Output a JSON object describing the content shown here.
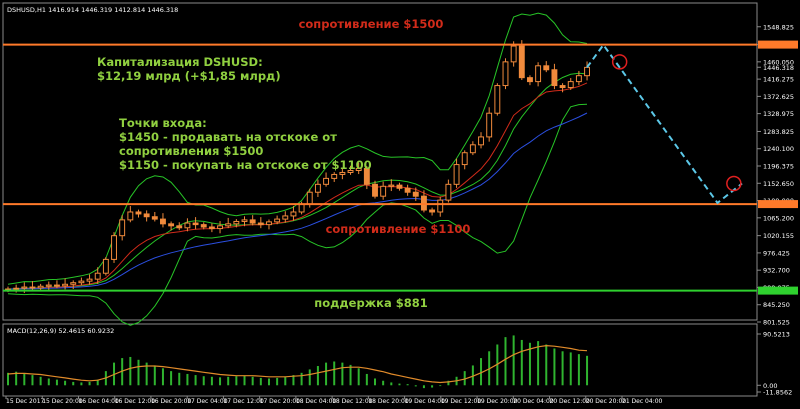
{
  "header": {
    "symbol_line": "DSHUSD,H1  1416.914 1446.319 1412.814 1446.318",
    "macd_line": "MACD(12,26,9) 52.4615 60.9232"
  },
  "annotations": {
    "resistance_top": "сопротивление $1500",
    "cap_line1": "Капитализация DSHUSD:",
    "cap_line2": "$12,19 млрд (+$1,85 млрд)",
    "entry_title": "Точки входа:",
    "entry_1": "$1450 - продавать на отскоке от",
    "entry_2": "сопротивления $1500",
    "entry_3": "$1150 - покупать на отскоке от $1100",
    "resistance_mid": "сопротивление $1100",
    "support": "поддержка $881"
  },
  "colors": {
    "background": "#000000",
    "candle_up": "#f08a3c",
    "candle_down": "#f08a3c",
    "resistance_line": "#ff7a2a",
    "support_line": "#2fd12f",
    "bollinger": "#27c427",
    "ma_red": "#d12b1a",
    "ma_blue": "#2b4fe0",
    "ma_green": "#27c427",
    "forecast": "#5cc8e8",
    "annotation_green": "#90d040",
    "annotation_red": "#d12b1a",
    "macd_bar": "#2fb42f",
    "macd_signal": "#e08a2a"
  },
  "chart_data": {
    "type": "candlestick",
    "symbol": "DSHUSD",
    "timeframe": "H1",
    "last_ohlc": {
      "open": 1416.914,
      "high": 1446.319,
      "low": 1412.814,
      "close": 1446.318
    },
    "price_ticks": [
      "1548.825",
      "1503.684",
      "1460.050",
      "1446.318",
      "1416.275",
      "1372.625",
      "1328.975",
      "1283.825",
      "1240.100",
      "1196.375",
      "1152.650",
      "1109.000",
      "1065.200",
      "1020.155",
      "976.425",
      "932.700",
      "888.975",
      "845.250",
      "801.525"
    ],
    "price_tick_values": [
      1548.825,
      1503.684,
      1460.05,
      1446.318,
      1416.275,
      1372.625,
      1328.975,
      1283.825,
      1240.1,
      1196.375,
      1152.65,
      1109.0,
      1065.2,
      1020.155,
      976.425,
      932.7,
      888.975,
      845.25,
      801.525
    ],
    "price_range": [
      801.525,
      1571
    ],
    "time_labels": [
      "15 Dec 2017",
      "15 Dec 20:00",
      "16 Dec 04:00",
      "16 Dec 12:00",
      "16 Dec 20:00",
      "17 Dec 04:00",
      "17 Dec 12:00",
      "17 Dec 20:00",
      "18 Dec 04:00",
      "18 Dec 12:00",
      "18 Dec 20:00",
      "19 Dec 04:00",
      "19 Dec 12:00",
      "19 Dec 20:00",
      "20 Dec 04:00",
      "20 Dec 12:00",
      "20 Dec 20:00",
      "21 Dec 04:00"
    ],
    "levels": [
      {
        "label": "сопротивление $1500",
        "value": 1503.684,
        "kind": "resistance"
      },
      {
        "label": "сопротивление $1100",
        "value": 1100,
        "kind": "resistance"
      },
      {
        "label": "поддержка $881",
        "value": 881,
        "kind": "support"
      }
    ],
    "price_series": [
      885,
      887,
      890,
      888,
      892,
      895,
      893,
      897,
      901,
      905,
      910,
      925,
      960,
      1020,
      1060,
      1080,
      1075,
      1068,
      1062,
      1050,
      1045,
      1040,
      1052,
      1048,
      1042,
      1038,
      1045,
      1050,
      1056,
      1060,
      1052,
      1048,
      1055,
      1062,
      1070,
      1080,
      1100,
      1130,
      1150,
      1165,
      1175,
      1180,
      1185,
      1190,
      1150,
      1120,
      1145,
      1148,
      1140,
      1130,
      1120,
      1085,
      1080,
      1110,
      1150,
      1200,
      1230,
      1250,
      1270,
      1330,
      1400,
      1460,
      1500,
      1420,
      1410,
      1450,
      1440,
      1400,
      1395,
      1410,
      1425,
      1446
    ],
    "forecast_path": [
      {
        "t": 71,
        "price": 1446
      },
      {
        "t": 73,
        "price": 1503
      },
      {
        "t": 87,
        "price": 1103
      },
      {
        "t": 90,
        "price": 1152
      }
    ],
    "targets": [
      {
        "t": 75,
        "price": 1460
      },
      {
        "t": 89,
        "price": 1152
      }
    ],
    "macd": {
      "ticks": [
        "90.5213",
        "0.00",
        "-11.8562"
      ],
      "tick_values": [
        90.5213,
        0,
        -11.8562
      ],
      "range": [
        -11.8562,
        90.5213
      ],
      "histogram": [
        22,
        24,
        20,
        18,
        15,
        12,
        10,
        8,
        6,
        5,
        6,
        10,
        25,
        40,
        48,
        50,
        45,
        40,
        35,
        30,
        25,
        22,
        20,
        18,
        16,
        15,
        14,
        15,
        16,
        17,
        15,
        13,
        12,
        13,
        15,
        18,
        22,
        28,
        34,
        40,
        42,
        40,
        36,
        30,
        20,
        12,
        8,
        5,
        3,
        2,
        -2,
        -5,
        -4,
        0,
        8,
        15,
        25,
        35,
        48,
        60,
        72,
        85,
        88,
        80,
        75,
        78,
        72,
        65,
        60,
        58,
        55,
        52
      ],
      "signal": [
        20,
        21,
        21,
        20,
        19,
        17,
        15,
        13,
        11,
        9,
        8,
        9,
        13,
        19,
        25,
        30,
        33,
        34,
        34,
        33,
        31,
        29,
        27,
        25,
        23,
        21,
        19,
        18,
        17,
        17,
        17,
        16,
        15,
        15,
        15,
        16,
        17,
        19,
        22,
        25,
        28,
        31,
        32,
        32,
        30,
        27,
        24,
        20,
        17,
        14,
        11,
        8,
        6,
        5,
        6,
        8,
        11,
        16,
        22,
        29,
        37,
        46,
        54,
        60,
        64,
        68,
        70,
        69,
        67,
        65,
        62,
        61
      ]
    }
  }
}
